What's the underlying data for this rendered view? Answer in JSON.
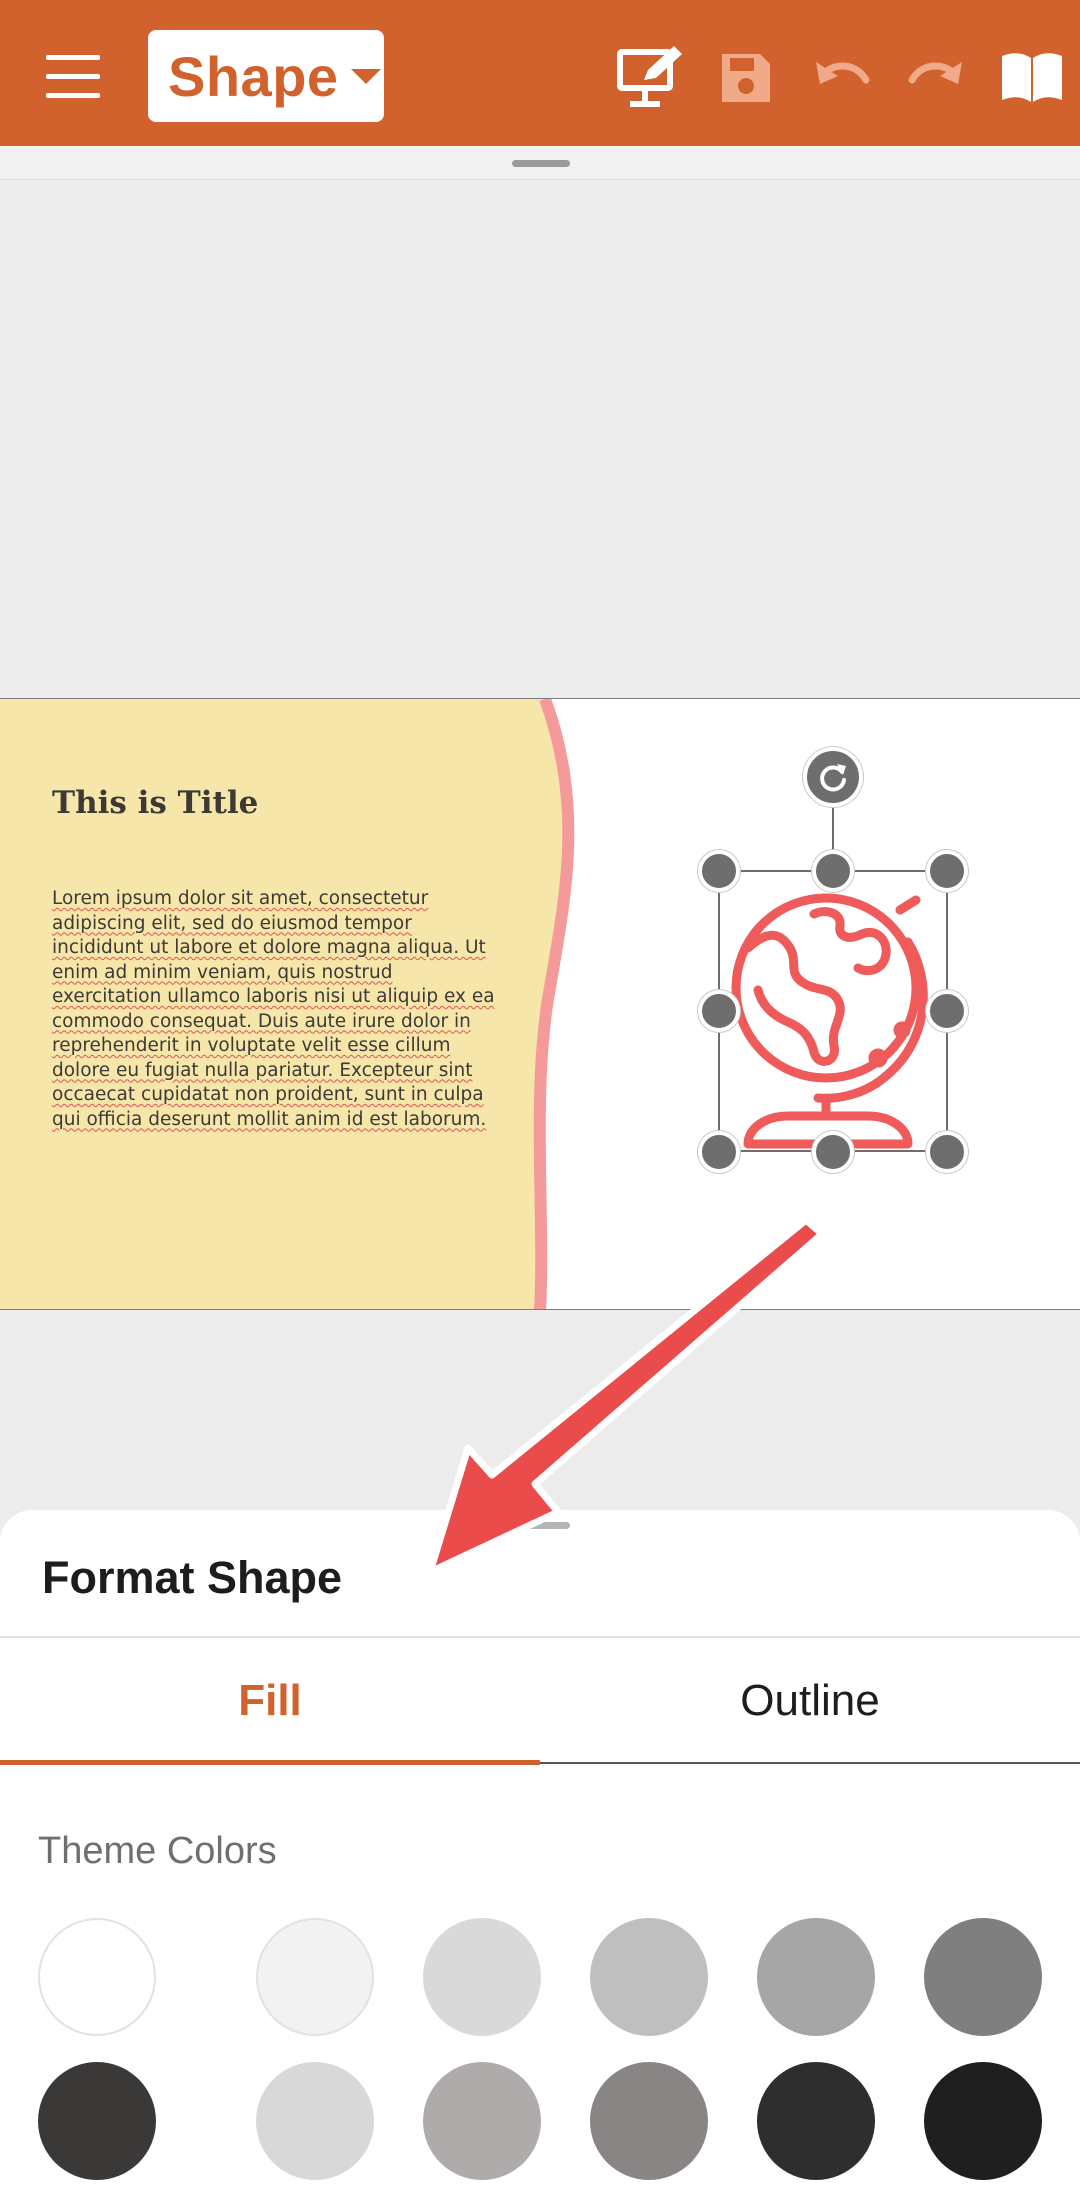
{
  "toolbar": {
    "mode_label": "Shape",
    "icons": [
      "menu-icon",
      "presentation-edit-icon",
      "save-icon",
      "undo-icon",
      "redo-icon",
      "book-icon"
    ],
    "accent_color": "#d1622e"
  },
  "slide": {
    "title": "This is Title",
    "body_lines": [
      "Lorem ipsum dolor sit amet, consectetur",
      "adipiscing elit, sed do eiusmod tempor",
      "incididunt ut labore et dolore magna aliqua. Ut",
      "enim ad minim veniam, quis nostrud",
      "exercitation ullamco laboris nisi ut aliquip ex ea",
      "commodo consequat. Duis aute irure dolor in",
      "reprehenderit in voluptate velit esse cillum",
      "dolore eu fugiat nulla pariatur. Excepteur sint",
      "occaecat cupidatat non proident, sunt in culpa",
      "qui officia deserunt mollit anim id est laborum."
    ],
    "panel_color": "#f7e6a9",
    "wave_color": "#f59a9a",
    "selected_shape_icon": "globe-icon",
    "shape_color": "#ef5a5a"
  },
  "format_sheet": {
    "title": "Format Shape",
    "tabs": [
      "Fill",
      "Outline"
    ],
    "active_tab": "Fill",
    "section_label": "Theme Colors",
    "theme_colors_row1": [
      "#ffffff",
      "#f2f2f2",
      "#d9d9d9",
      "#bfbfbf",
      "#a6a6a6",
      "#7f7f7f"
    ],
    "theme_colors_row2": [
      "#3b3838",
      "#d8d8d8",
      "#afabab",
      "#898585",
      "#2e2e2e",
      "#1f1f1f"
    ]
  }
}
